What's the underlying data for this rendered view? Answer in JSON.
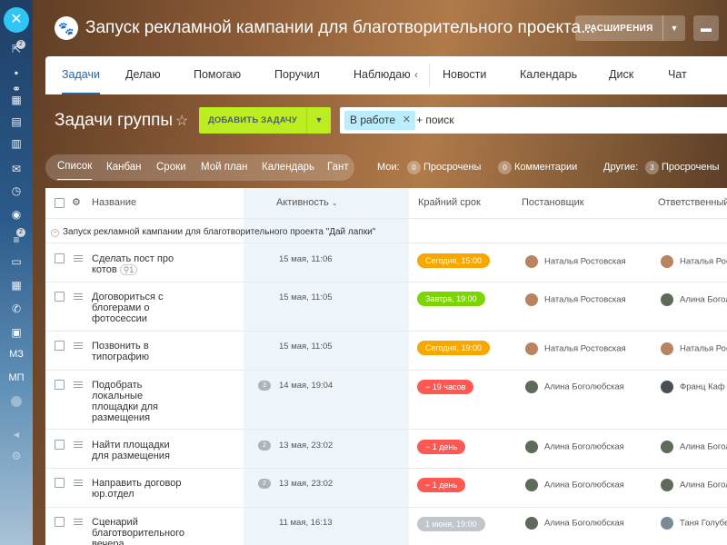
{
  "app": {
    "title": "Запуск рекламной кампании для благотворительного проекта...",
    "extensions_label": "РАСШИРЕНИЯ",
    "logo_icon": "paw-icon"
  },
  "leftbar": {
    "badges": [
      "2",
      "2"
    ],
    "labels": [
      "МЗ",
      "МП"
    ]
  },
  "tabs": [
    {
      "label": "Задачи",
      "active": true
    },
    {
      "label": "Делаю"
    },
    {
      "label": "Помогаю"
    },
    {
      "label": "Поручил"
    },
    {
      "label": "Наблюдаю"
    },
    {
      "label": "Новости"
    },
    {
      "label": "Календарь"
    },
    {
      "label": "Диск"
    },
    {
      "label": "Чат"
    }
  ],
  "toolbar": {
    "heading": "Задачи группы",
    "add_task_label": "ДОБАВИТЬ ЗАДАЧУ",
    "filter_chip": "В работе",
    "search_placeholder": "+ поиск"
  },
  "views": [
    {
      "label": "Список",
      "active": true
    },
    {
      "label": "Канбан"
    },
    {
      "label": "Сроки"
    },
    {
      "label": "Мой план"
    },
    {
      "label": "Календарь"
    },
    {
      "label": "Гант"
    }
  ],
  "counters": {
    "my_label": "Мои:",
    "my_overdue_count": "0",
    "my_overdue_label": "Просрочены",
    "comments_count": "0",
    "comments_label": "Комментарии",
    "others_label": "Другие:",
    "others_overdue_count": "3",
    "others_overdue_label": "Просрочены"
  },
  "table": {
    "columns": {
      "name": "Название",
      "activity": "Активность",
      "deadline": "Крайний срок",
      "creator": "Постановщик",
      "responsible": "Ответственный"
    },
    "group_title": "Запуск рекламной кампании для благотворительного проекта \"Дай лапки\"",
    "rows": [
      {
        "name": "Сделать пост про котов",
        "subtasks": "1",
        "activity": "15 мая, 11:06",
        "comments": "",
        "deadline": "Сегодня, 15:00",
        "deadline_color": "#f7a700",
        "creator": "Наталья Ростовская",
        "responsible": "Наталья Ростовская"
      },
      {
        "name": "Договориться с блогерами о фотосессии",
        "subtasks": "",
        "activity": "15 мая, 11:05",
        "comments": "",
        "deadline": "Завтра, 19:00",
        "deadline_color": "#7bd500",
        "creator": "Наталья Ростовская",
        "responsible": "Алина Богол"
      },
      {
        "name": "Позвонить в типографию",
        "subtasks": "",
        "activity": "15 мая, 11:05",
        "comments": "",
        "deadline": "Сегодня, 19:00",
        "deadline_color": "#f7a700",
        "creator": "Наталья Ростовская",
        "responsible": "Наталья Рос"
      },
      {
        "name": "Подобрать локальные площадки для размещения",
        "subtasks": "",
        "activity": "14 мая, 19:04",
        "comments": "3",
        "deadline": "− 19 часов",
        "deadline_color": "#ff5752",
        "creator": "Алина Боголюбская",
        "responsible": "Франц Каф"
      },
      {
        "name": "Найти площадки для размещения",
        "subtasks": "",
        "activity": "13 мая, 23:02",
        "comments": "2",
        "deadline": "− 1 день",
        "deadline_color": "#ff5752",
        "creator": "Алина Боголюбская",
        "responsible": "Алина Богол"
      },
      {
        "name": "Направить договор юр.отдел",
        "subtasks": "",
        "activity": "13 мая, 23:02",
        "comments": "2",
        "deadline": "− 1 день",
        "deadline_color": "#ff5752",
        "creator": "Алина Боголюбская",
        "responsible": "Алина Богол"
      },
      {
        "name": "Сценарий благотворительного вечера",
        "subtasks": "",
        "activity": "11 мая, 16:13",
        "comments": "",
        "deadline": "1 июня, 19:00",
        "deadline_color": "#c0c6cc",
        "creator": "Алина Боголюбская",
        "responsible": "Таня Голубе"
      }
    ]
  }
}
